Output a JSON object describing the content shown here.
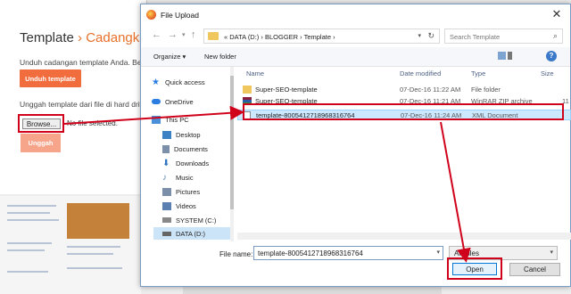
{
  "background": {
    "title_part1": "Template",
    "title_sep": "›",
    "title_part2": "Cadangkan",
    "backup_desc": "Unduh cadangan template Anda. Be",
    "download_button": "Unduh template",
    "upload_desc": "Unggah template dari file di hard driv",
    "browse_button": "Browse...",
    "no_file_text": "No file selected.",
    "upload_button": "Unggah"
  },
  "dialog": {
    "title": "File Upload",
    "close_glyph": "✕",
    "address_path": "«  DATA (D:)  ›  BLOGGER  ›  Template  ›",
    "search_placeholder": "Search Template",
    "organize_label": "Organize ▾",
    "new_folder_label": "New folder",
    "nav_items": [
      {
        "label": "Quick access",
        "icon": "star-icon",
        "color": "#2b7de1"
      },
      {
        "label": "OneDrive",
        "icon": "cloud-icon",
        "color": "#2b7de1"
      },
      {
        "label": "This PC",
        "icon": "computer-icon",
        "color": "#4a90d9"
      },
      {
        "label": "Desktop",
        "icon": "desktop-icon",
        "color": "#3b82c4"
      },
      {
        "label": "Documents",
        "icon": "documents-icon",
        "color": "#7b8fa8"
      },
      {
        "label": "Downloads",
        "icon": "downloads-icon",
        "color": "#2e74c0"
      },
      {
        "label": "Music",
        "icon": "music-icon",
        "color": "#5a7fb0"
      },
      {
        "label": "Pictures",
        "icon": "pictures-icon",
        "color": "#7b8fa8"
      },
      {
        "label": "Videos",
        "icon": "videos-icon",
        "color": "#5a7fb0"
      },
      {
        "label": "SYSTEM (C:)",
        "icon": "drive-icon",
        "color": "#888888"
      },
      {
        "label": "DATA (D:)",
        "icon": "drive-icon",
        "color": "#666666"
      }
    ],
    "columns": [
      "Name",
      "Date modified",
      "Type",
      "Size"
    ],
    "files": [
      {
        "name": "Super-SEO-template",
        "date": "07-Dec-16 11:22 AM",
        "type": "File folder",
        "size": "",
        "icon": "folder-icon"
      },
      {
        "name": "Super-SEO-template",
        "date": "07-Dec-16 11:21 AM",
        "type": "WinRAR ZIP archive",
        "size": "11",
        "icon": "zip-icon"
      },
      {
        "name": "template-8005412718968316764",
        "date": "07-Dec-16 11:24 AM",
        "type": "XML Document",
        "size": "",
        "icon": "xml-file-icon"
      }
    ],
    "file_name_label": "File name:",
    "file_name_value": "template-8005412718968316764",
    "file_type_value": "All Files",
    "open_button": "Open",
    "cancel_button": "Cancel"
  },
  "colors": {
    "accent_orange": "#f26d3d",
    "annotation_red": "#d0021b",
    "selection_blue": "#cce8ff"
  }
}
